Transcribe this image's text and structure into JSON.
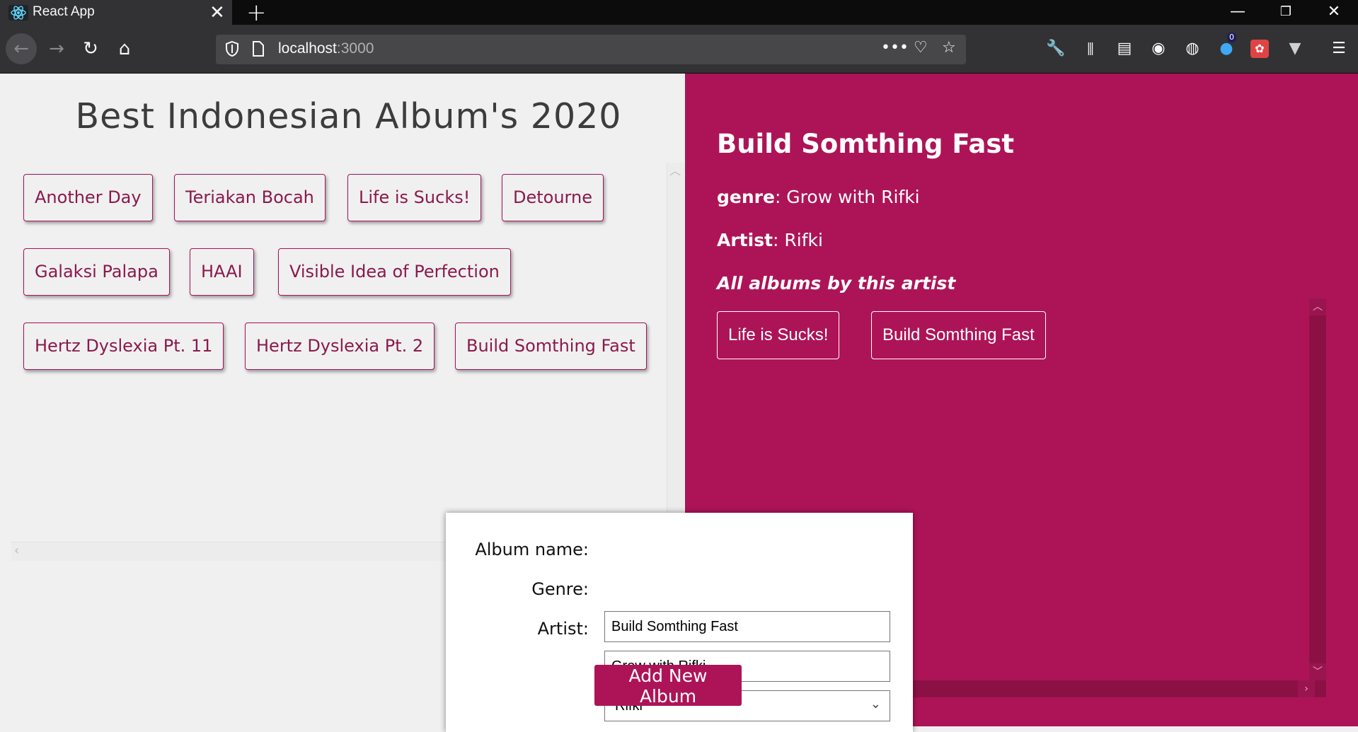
{
  "browser": {
    "tab_title": "React App",
    "url_host": "localhost",
    "url_port": ":3000",
    "notification_count": "0",
    "colors": {
      "chrome": "#323234",
      "tabbar": "#0c0c0d",
      "urlbar": "#474749"
    }
  },
  "page": {
    "title": "Best Indonesian Album's 2020",
    "albums": [
      "Another Day",
      "Teriakan Bocah",
      "Life is Sucks!",
      "Detourne",
      "Galaksi Palapa",
      "HAAI",
      "Visible Idea of Perfection",
      "Hertz Dyslexia Pt. 11",
      "Hertz Dyslexia Pt. 2",
      "Build Somthing Fast"
    ],
    "colors": {
      "accent": "#ad1457",
      "background": "#f0f0f0"
    }
  },
  "detail": {
    "title": "Build Somthing Fast",
    "genre_label": "genre",
    "genre_value": ": Grow with Rifki",
    "artist_label": "Artist",
    "artist_value": ": Rifki",
    "all_albums_heading": "All albums by this artist",
    "artist_albums": [
      "Life is Sucks!",
      "Build Somthing Fast"
    ]
  },
  "form": {
    "album_name_label": "Album name:",
    "album_name_value": "Build Somthing Fast",
    "genre_label": "Genre:",
    "genre_value": "Grow with Rifki",
    "artist_label": "Artist:",
    "artist_value": "Rifki",
    "submit_label": "Add New Album"
  }
}
